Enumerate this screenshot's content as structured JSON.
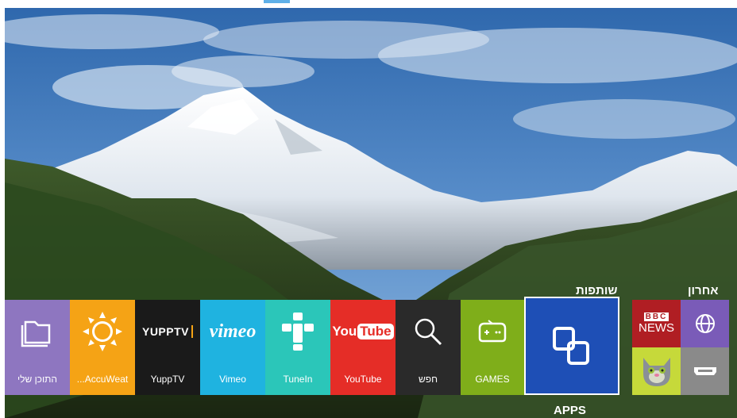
{
  "hub": {
    "partners_label": "שותפות",
    "recent_label": "אחרון",
    "apps_label": "APPS"
  },
  "tiles": [
    {
      "label": "התוכן שלי",
      "color": "#8e76c0",
      "icon": "folder-icon"
    },
    {
      "label": "...AccuWeat",
      "color": "#f5a315",
      "icon": "sun-icon"
    },
    {
      "label": "YuppTV",
      "color": "#1a1a1a",
      "icon": "yupptv-logo",
      "logo": "YUPPTV"
    },
    {
      "label": "Vimeo",
      "color": "#1fb3e0",
      "icon": "vimeo-logo",
      "logo": "vimeo"
    },
    {
      "label": "TuneIn",
      "color": "#2bc6b9",
      "icon": "tunein-icon"
    },
    {
      "label": "YouTube",
      "color": "#e52d27",
      "icon": "youtube-logo",
      "logo_a": "You",
      "logo_b": "Tube"
    },
    {
      "label": "חפש",
      "color": "#2a2a2a",
      "icon": "search-icon"
    },
    {
      "label": "GAMES",
      "color": "#7fae1a",
      "icon": "gamepad-icon"
    }
  ],
  "recent": {
    "bbc_top": "BBC",
    "bbc_bottom": "NEWS",
    "colors": {
      "bbc": "#b01e23",
      "web": "#7a5bb8",
      "talking_tom": "#c6d93a",
      "hdmi": "#8a8a8a"
    }
  }
}
